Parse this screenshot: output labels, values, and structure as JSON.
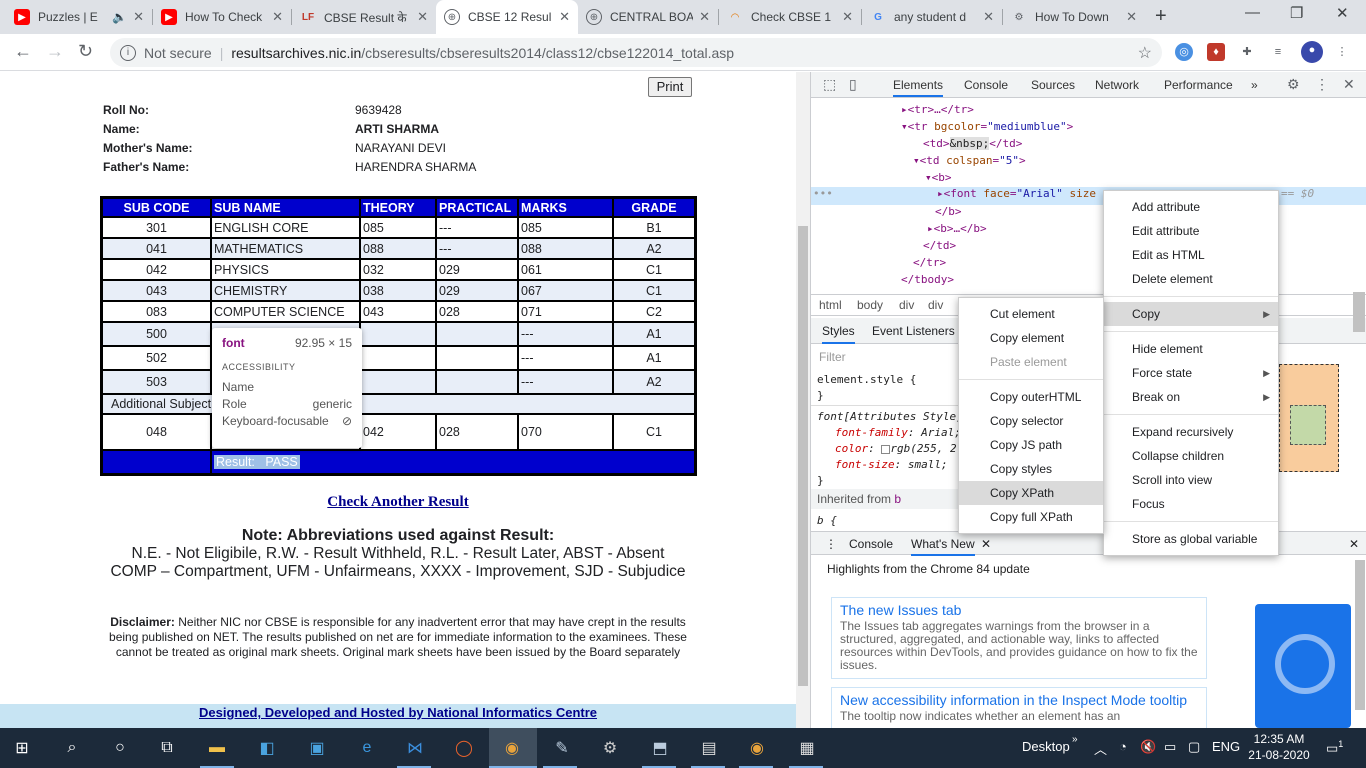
{
  "browser": {
    "tabs": [
      {
        "title": "Puzzles | E",
        "icon": "youtube-icon",
        "color": "#ff0000",
        "audio": true
      },
      {
        "title": "How To Check",
        "icon": "youtube-icon",
        "color": "#ff0000"
      },
      {
        "title": "CBSE Result के",
        "icon": "lf-icon",
        "color": "#c0392b"
      },
      {
        "title": "CBSE 12 Resul",
        "icon": "globe-icon",
        "color": "#5f6368",
        "active": true
      },
      {
        "title": "CENTRAL BOA",
        "icon": "globe-icon",
        "color": "#5f6368"
      },
      {
        "title": "Check CBSE 1",
        "icon": "rainbow-icon",
        "color": "#e37400"
      },
      {
        "title": "any student d",
        "icon": "google-icon",
        "color": "#4285f4"
      },
      {
        "title": "How To Down",
        "icon": "gear-globe-icon",
        "color": "#5f6368"
      }
    ],
    "new_tab": "+",
    "omnibox": {
      "security": "Not secure",
      "host": "resultsarchives.nic.in",
      "path": "/cbseresults/cbseresults2014/class12/cbse122014_total.asp"
    }
  },
  "result_page": {
    "print_label": "Print",
    "info": [
      {
        "label": "Roll No:",
        "value": "9639428"
      },
      {
        "label": "Name:",
        "value": "ARTI SHARMA",
        "bold": true
      },
      {
        "label": "Mother's Name:",
        "value": "NARAYANI DEVI"
      },
      {
        "label": "Father's Name:",
        "value": "HARENDRA SHARMA"
      }
    ],
    "table_header": [
      "SUB CODE",
      "SUB NAME",
      "THEORY",
      "PRACTICAL",
      "MARKS",
      "GRADE"
    ],
    "rows": [
      [
        "301",
        "ENGLISH CORE",
        "085",
        "---",
        "085",
        "B1"
      ],
      [
        "041",
        "MATHEMATICS",
        "088",
        "---",
        "088",
        "A2"
      ],
      [
        "042",
        "PHYSICS",
        "032",
        "029",
        "061",
        "C1"
      ],
      [
        "043",
        "CHEMISTRY",
        "038",
        "029",
        "067",
        "C1"
      ],
      [
        "083",
        "COMPUTER SCIENCE",
        "043",
        "028",
        "071",
        "C2"
      ],
      [
        "500",
        "",
        "",
        "",
        "---",
        "A1"
      ],
      [
        "502",
        "",
        "",
        "",
        "---",
        "A1"
      ],
      [
        "503",
        "",
        "",
        "",
        "---",
        "A2"
      ]
    ],
    "additional_label": "Additional Subject",
    "additional_row": [
      "048",
      "",
      "042",
      "028",
      "070",
      "C1"
    ],
    "result_text": "Result:   PASS",
    "check_another": "Check Another Result",
    "note_title": "Note: Abbreviations used against Result:",
    "note_line1": "N.E. - Not Eligibile, R.W. - Result Withheld, R.L. - Result Later, ABST - Absent",
    "note_line2": "COMP – Compartment, UFM - Unfairmeans, XXXX - Improvement, SJD - Subjudice",
    "disclaimer_label": "Disclaimer:",
    "disclaimer_text": " Neither NIC nor CBSE is responsible for any inadvertent error that may have crept in the results being published on NET. The results published on net are for immediate information to the examinees. These cannot be treated as original mark sheets. Original mark sheets have been issued by the Board separately",
    "footer_link": "Designed, Developed and Hosted by National Informatics Centre"
  },
  "tooltip": {
    "tag": "font",
    "size": "92.95 × 15",
    "section": "ACCESSIBILITY",
    "rows": [
      {
        "label": "Name",
        "value": ""
      },
      {
        "label": "Role",
        "value": "generic"
      },
      {
        "label": "Keyboard-focusable",
        "value": ""
      }
    ]
  },
  "devtools": {
    "tabs": [
      "Elements",
      "Console",
      "Sources",
      "Network",
      "Performance"
    ],
    "more": "»",
    "dom_lines": [
      {
        "indent": 0,
        "html": "▸<tr>…</tr>"
      },
      {
        "indent": 0,
        "tag": "▾<tr ",
        "attr": "bgcolor",
        "val": "\"mediumblue\"",
        "end": ">"
      },
      {
        "indent": 1,
        "tag": "<td>",
        "text": "&nbsp;",
        "end": "</td>"
      },
      {
        "indent": 1,
        "tag": "▾<td ",
        "attr": "colspan",
        "val": "\"5\"",
        "end": ">"
      },
      {
        "indent": 2,
        "tag": "▾<b>"
      },
      {
        "indent": 3,
        "tag": "▸<font ",
        "attr": "face",
        "val": "\"Arial\"",
        "end": " size"
      },
      {
        "indent": 2,
        "tag": "</b>"
      },
      {
        "indent": 2,
        "tag": "▸<b>…</b>"
      },
      {
        "indent": 1,
        "tag": "</td>"
      },
      {
        "indent": 0,
        "tag": "</tr>"
      },
      {
        "indent": -1,
        "tag": "</tbody>"
      }
    ],
    "selected_suffix": "== $0",
    "breadcrumbs": [
      "html",
      "body",
      "div",
      "div"
    ],
    "style_tabs": [
      "Styles",
      "Event Listeners"
    ],
    "filter_placeholder": "Filter",
    "element_style": "element.style {",
    "attr_style_title": "font[Attributes Style]",
    "props": [
      {
        "name": "font-family",
        "value": "Arial;"
      },
      {
        "name": "color",
        "value": "rgb(255, 2"
      },
      {
        "name": "font-size",
        "value": "small;"
      }
    ],
    "inherited": "Inherited from",
    "inherited_tag": "b",
    "b_rule": "b {",
    "drawer_tabs": [
      "Console",
      "What's New"
    ],
    "drawer_heading": "Highlights from the Chrome 84 update",
    "cards": [
      {
        "title": "The new Issues tab",
        "body": "The Issues tab aggregates warnings from the browser in a structured, aggregated, and actionable way, links to affected resources within DevTools, and provides guidance on how to fix the issues."
      },
      {
        "title": "New accessibility information in the Inspect Mode tooltip",
        "body": "The tooltip now indicates whether an element has an"
      }
    ]
  },
  "context_menu": {
    "items": [
      "Add attribute",
      "Edit attribute",
      "Edit as HTML",
      "Delete element",
      "Copy",
      "Hide element",
      "Force state",
      "Break on",
      "Expand recursively",
      "Collapse children",
      "Scroll into view",
      "Focus",
      "Store as global variable"
    ],
    "copy_submenu": [
      "Cut element",
      "Copy element",
      "Paste element",
      "Copy outerHTML",
      "Copy selector",
      "Copy JS path",
      "Copy styles",
      "Copy XPath",
      "Copy full XPath"
    ]
  },
  "taskbar": {
    "desktop_label": "Desktop",
    "language": "ENG",
    "time": "12:35 AM",
    "date": "21-08-2020",
    "notification_count": "1"
  },
  "colors": {
    "table_header": "#0000cd",
    "link": "#00008b",
    "footer_bg": "#c7e4f3",
    "devtools_accent": "#1a73e8"
  }
}
